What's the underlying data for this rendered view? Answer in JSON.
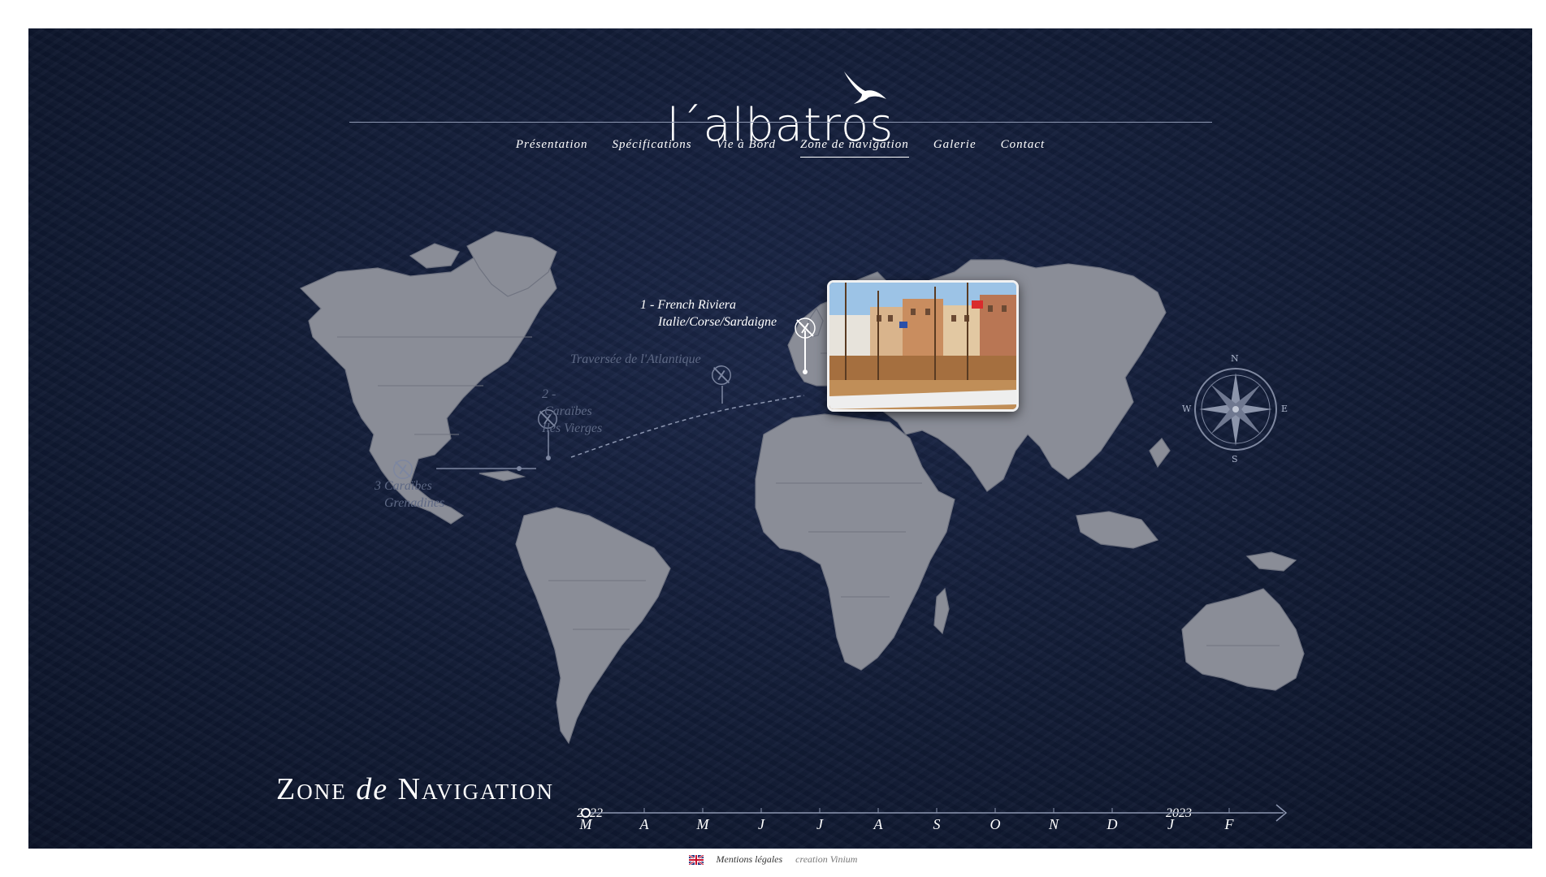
{
  "brand": {
    "logo_text": "l´albatros"
  },
  "nav": {
    "items": [
      {
        "label": "Présentation"
      },
      {
        "label": "Spécifications"
      },
      {
        "label": "Vie à Bord"
      },
      {
        "label": "Zone de navigation"
      },
      {
        "label": "Galerie"
      },
      {
        "label": "Contact"
      }
    ],
    "active_index": 3
  },
  "map": {
    "stops": [
      {
        "number": "1 - ",
        "line1": "French Riviera",
        "line2": "Italie/Corse/Sardaigne",
        "active": true
      },
      {
        "line1": "Traversée de l'Atlantique",
        "active": false
      },
      {
        "number": "2 -",
        "line1": "Caraïbes",
        "line2": "Iles Vierges",
        "active": false
      },
      {
        "number": "3 ",
        "line1": "Caraïbes",
        "line2": "Grenadines",
        "active": false
      }
    ],
    "compass": {
      "n": "N",
      "s": "S",
      "e": "E",
      "w": "W"
    }
  },
  "section": {
    "title_pre": "Zone ",
    "title_mid": "de",
    "title_post": " Navigation"
  },
  "timeline": {
    "start_year": "2022",
    "end_year": "2023",
    "months": [
      "M",
      "A",
      "M",
      "J",
      "J",
      "A",
      "S",
      "O",
      "N",
      "D",
      "J",
      "F"
    ],
    "current_index": 0
  },
  "footer": {
    "legal": "Mentions légales",
    "credit": "creation Vinium",
    "flag": "uk-flag-icon"
  },
  "colors": {
    "ocean": "#121c36",
    "land": "#8a8d97",
    "text": "#ffffff",
    "dim_text": "#5d6884"
  }
}
